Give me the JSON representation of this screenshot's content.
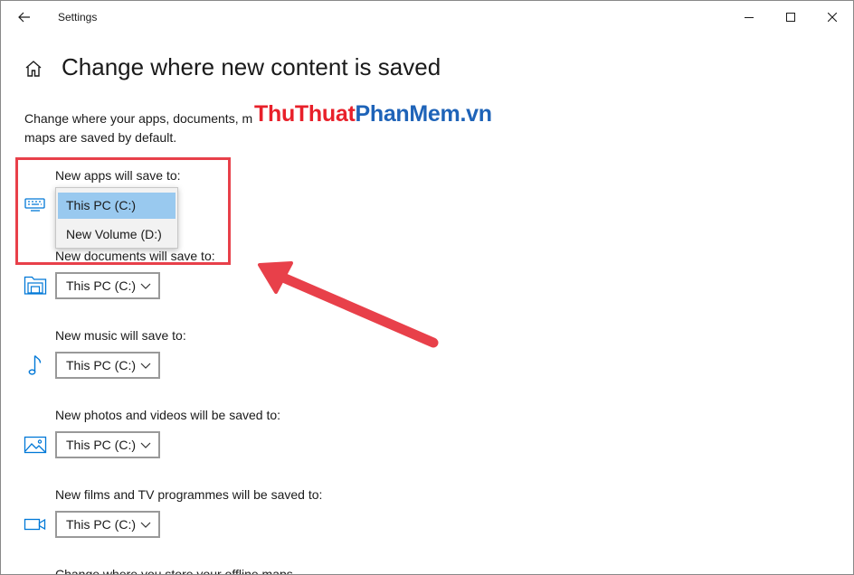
{
  "window": {
    "title": "Settings",
    "controls": [
      "minimize",
      "maximize",
      "close"
    ]
  },
  "page": {
    "title": "Change where new content is saved",
    "description_line1": "Change where your apps, documents, m",
    "description_line2": "maps are saved by default."
  },
  "watermark": {
    "part1": "Thu",
    "part2": "Thuat",
    "part3": "Phan",
    "part4": "Mem",
    "part5": ".vn"
  },
  "sections": [
    {
      "label": "New apps will save to:",
      "value": "This PC (C:)",
      "icon": "monitor-keyboard-icon",
      "expanded": true
    },
    {
      "label": "New documents will save to:",
      "value": "This PC (C:)",
      "icon": "documents-folder-icon"
    },
    {
      "label": "New music will save to:",
      "value": "This PC (C:)",
      "icon": "music-note-icon"
    },
    {
      "label": "New photos and videos will be saved to:",
      "value": "This PC (C:)",
      "icon": "picture-icon"
    },
    {
      "label": "New films and TV programmes will be saved to:",
      "value": "This PC (C:)",
      "icon": "video-camera-icon"
    },
    {
      "label": "Change where you store your offline maps"
    }
  ],
  "apps_dropdown_options": [
    "This PC (C:)",
    "New Volume (D:)"
  ],
  "colors": {
    "accent": "#0078d7",
    "selected_option": "#99c9ef",
    "annotation": "#e8404a"
  }
}
